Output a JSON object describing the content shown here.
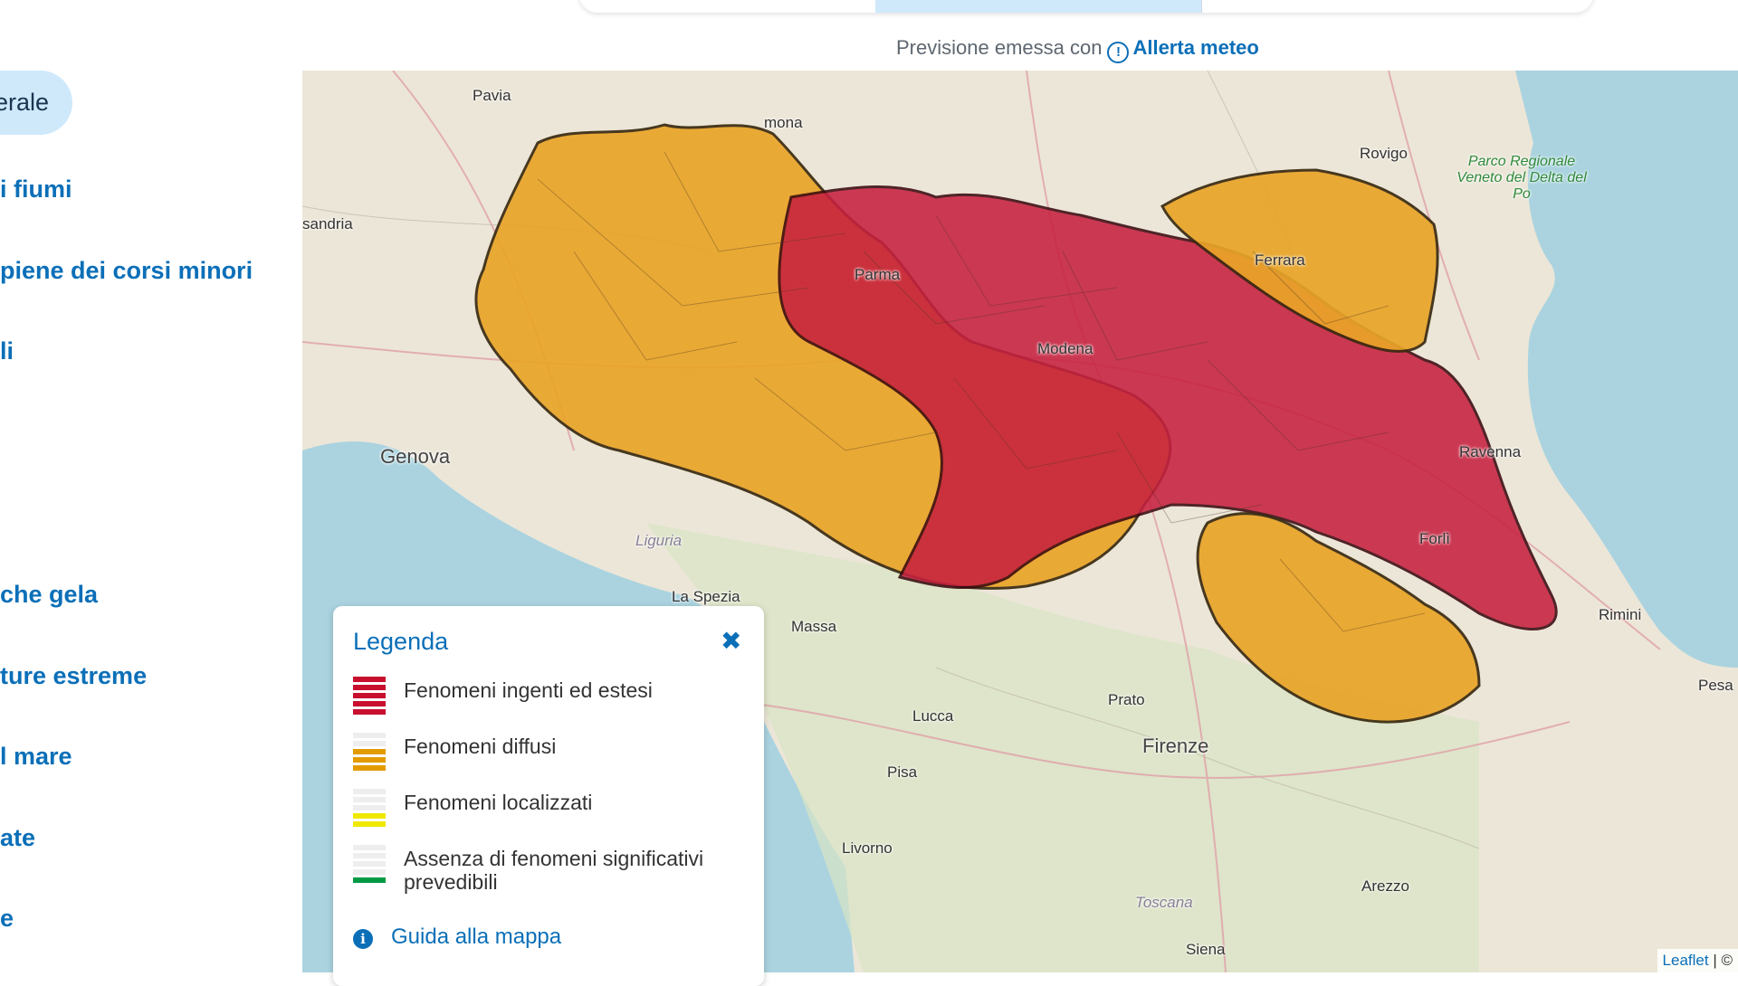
{
  "issued": {
    "prefix": "Previsione emessa con",
    "link_label": "Allerta meteo"
  },
  "menu": {
    "items": [
      {
        "label": "erale",
        "active": true
      },
      {
        "label": "i fiumi"
      },
      {
        "label": "piene dei corsi minori"
      },
      {
        "label": "li"
      },
      {
        "label": "che gela"
      },
      {
        "label": "ture estreme"
      },
      {
        "label": "l mare"
      },
      {
        "label": "ate"
      },
      {
        "label": "e"
      }
    ]
  },
  "map": {
    "places": {
      "pavia": "Pavia",
      "cremona": "mona",
      "rovigo": "Rovigo",
      "alessandria": "sandria",
      "park": "Parco Regionale Veneto del Delta del Po",
      "ferrara": "Ferrara",
      "parma": "Parma",
      "modena": "Modena",
      "genova": "Genova",
      "ravenna": "Ravenna",
      "liguria": "Liguria",
      "forli": "Forlì",
      "la_spezia": "La Spezia",
      "massa": "Massa",
      "rimini": "Rimini",
      "pesaro": "Pesa",
      "prato": "Prato",
      "lucca": "Lucca",
      "firenze": "Firenze",
      "pisa": "Pisa",
      "livorno": "Livorno",
      "arezzo": "Arezzo",
      "toscana": "Toscana",
      "siena": "Siena"
    },
    "attribution": {
      "leaflet": "Leaflet",
      "separator": "| ©"
    },
    "colors": {
      "red_zone": "#c7213f",
      "orange_zone": "#e9a428",
      "sea": "#aad3df",
      "land": "#ece6d8"
    }
  },
  "legend": {
    "title": "Legenda",
    "close_icon": "close-icon",
    "items": [
      {
        "label": "Fenomeni ingenti ed estesi",
        "color": "#c8102e"
      },
      {
        "label": "Fenomeni diffusi",
        "color": "#e39b00"
      },
      {
        "label": "Fenomeni localizzati",
        "color": "#f0e800"
      },
      {
        "label": "Assenza di fenomeni significativi prevedibili",
        "color": "#009a44"
      }
    ],
    "guide_label": "Guida alla mappa"
  }
}
